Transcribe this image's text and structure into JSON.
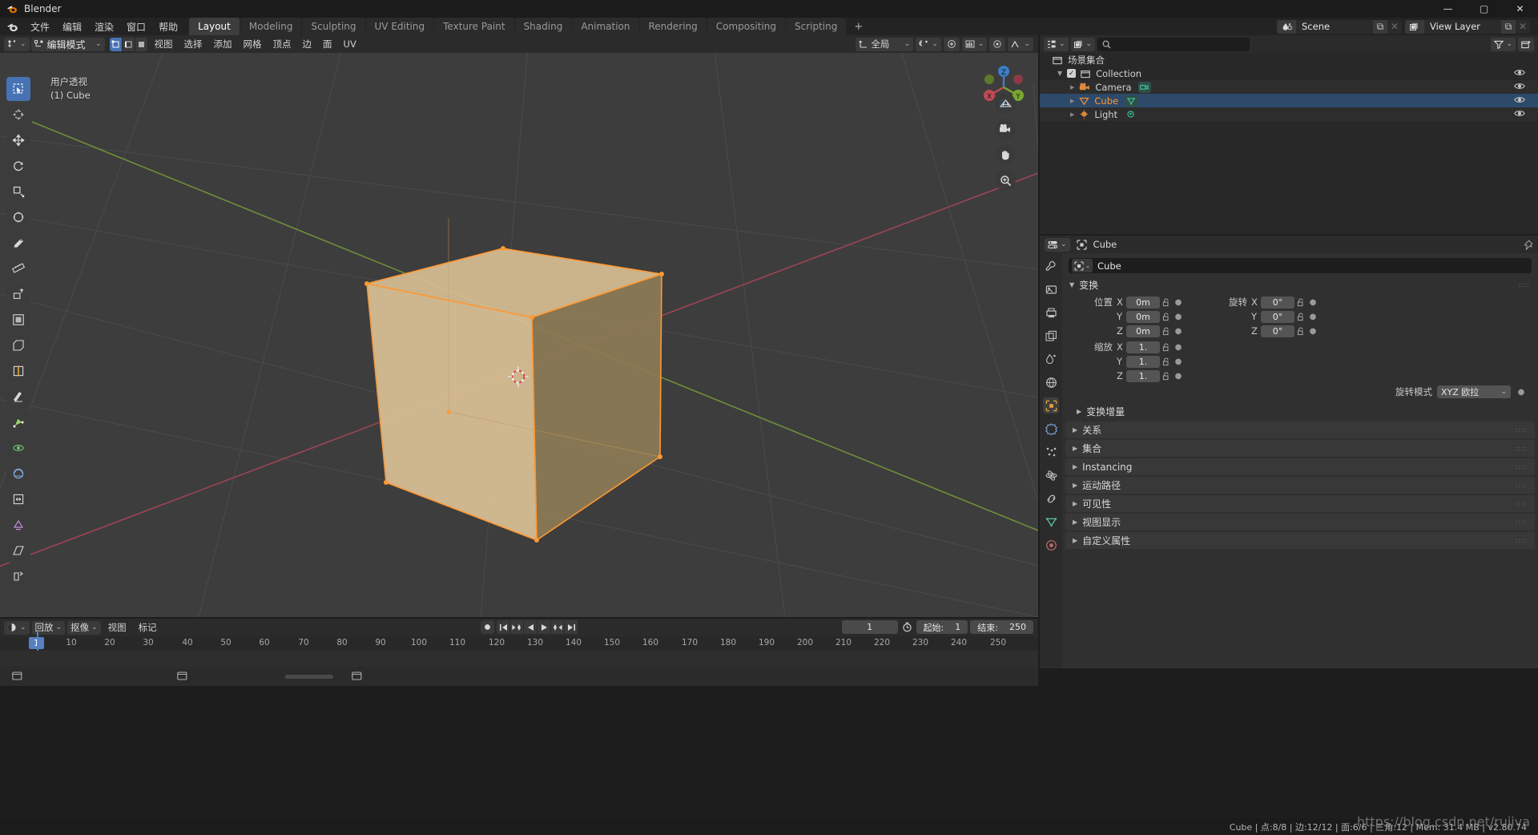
{
  "window": {
    "title": "Blender",
    "minimize_label": "—",
    "maximize_label": "▢",
    "close_label": "✕"
  },
  "topbar": {
    "menus": [
      "文件",
      "编辑",
      "渲染",
      "窗口",
      "帮助"
    ],
    "workspaces": [
      {
        "label": "Layout",
        "active": true
      },
      {
        "label": "Modeling",
        "active": false
      },
      {
        "label": "Sculpting",
        "active": false
      },
      {
        "label": "UV Editing",
        "active": false
      },
      {
        "label": "Texture Paint",
        "active": false
      },
      {
        "label": "Shading",
        "active": false
      },
      {
        "label": "Animation",
        "active": false
      },
      {
        "label": "Rendering",
        "active": false
      },
      {
        "label": "Compositing",
        "active": false
      },
      {
        "label": "Scripting",
        "active": false
      }
    ],
    "add_workspace_label": "+",
    "scene": {
      "name": "Scene",
      "new_label": "⧉",
      "unlink_label": "✕"
    },
    "view_layer": {
      "name": "View Layer",
      "new_label": "⧉",
      "unlink_label": "✕"
    }
  },
  "viewport": {
    "mode": "编辑模式",
    "select_modes": [
      {
        "name": "vertex-select",
        "active": true
      },
      {
        "name": "edge-select",
        "active": false
      },
      {
        "name": "face-select",
        "active": false
      }
    ],
    "menus": [
      "视图",
      "选择",
      "添加",
      "网格",
      "顶点",
      "边",
      "面",
      "UV"
    ],
    "transform_orientation": "全局",
    "overlay_text_line1": "用户透视",
    "overlay_text_line2": "(1) Cube",
    "gizmo_axes": {
      "x": "X",
      "y": "Y",
      "z": "Z"
    },
    "nav_buttons": [
      "grid-toggle",
      "camera-view",
      "pan-view",
      "zoom-view"
    ],
    "tools": [
      {
        "name": "select-box",
        "active": true
      },
      {
        "name": "cursor",
        "active": false
      },
      {
        "name": "move",
        "active": false
      },
      {
        "name": "rotate",
        "active": false
      },
      {
        "name": "scale",
        "active": false
      },
      {
        "name": "transform",
        "active": false
      },
      {
        "name": "annotate",
        "active": false
      },
      {
        "name": "measure",
        "active": false
      },
      {
        "name": "extrude-region",
        "active": false
      },
      {
        "name": "inset-faces",
        "active": false
      },
      {
        "name": "bevel",
        "active": false
      },
      {
        "name": "loop-cut",
        "active": false
      },
      {
        "name": "knife",
        "active": false
      },
      {
        "name": "poly-build",
        "active": false
      },
      {
        "name": "spin",
        "active": false
      },
      {
        "name": "smooth",
        "active": false
      },
      {
        "name": "edge-slide",
        "active": false
      },
      {
        "name": "shrink-fatten",
        "active": false
      },
      {
        "name": "shear",
        "active": false
      },
      {
        "name": "rip-region",
        "active": false
      }
    ]
  },
  "outliner": {
    "search_placeholder": "",
    "root_label": "场景集合",
    "items": [
      {
        "label": "Collection",
        "type": "collection",
        "indent": 1,
        "selected": false,
        "expander": "▼",
        "checkbox": true
      },
      {
        "label": "Camera",
        "type": "camera",
        "indent": 2,
        "selected": false,
        "expander": "▶",
        "checkbox": false
      },
      {
        "label": "Cube",
        "type": "mesh",
        "indent": 2,
        "selected": true,
        "expander": "▶",
        "checkbox": false
      },
      {
        "label": "Light",
        "type": "light",
        "indent": 2,
        "selected": false,
        "expander": "▶",
        "checkbox": false
      }
    ]
  },
  "properties": {
    "breadcrumb_object": "Cube",
    "name_value": "Cube",
    "transform": {
      "title": "变换",
      "location_label": "位置",
      "rotation_label": "旋转",
      "scale_label": "缩放",
      "axes": [
        "X",
        "Y",
        "Z"
      ],
      "location": [
        "0m",
        "0m",
        "0m"
      ],
      "rotation": [
        "0°",
        "0°",
        "0°"
      ],
      "scale": [
        "1.",
        "1.",
        "1."
      ],
      "rotation_mode_label": "旋转模式",
      "rotation_mode_value": "XYZ 欧拉"
    },
    "panels": [
      {
        "label": "变换增量",
        "sub": true
      },
      {
        "label": "关系",
        "sub": false
      },
      {
        "label": "集合",
        "sub": false
      },
      {
        "label": "Instancing",
        "sub": false
      },
      {
        "label": "运动路径",
        "sub": false
      },
      {
        "label": "可见性",
        "sub": false
      },
      {
        "label": "视图显示",
        "sub": false
      },
      {
        "label": "自定义属性",
        "sub": false
      }
    ],
    "tabs": [
      {
        "name": "tool",
        "active": false
      },
      {
        "name": "render",
        "active": false
      },
      {
        "name": "output",
        "active": false
      },
      {
        "name": "view-layer",
        "active": false
      },
      {
        "name": "scene",
        "active": false
      },
      {
        "name": "world",
        "active": false
      },
      {
        "name": "object",
        "active": true
      },
      {
        "name": "modifiers",
        "active": false
      },
      {
        "name": "particles",
        "active": false
      },
      {
        "name": "physics",
        "active": false
      },
      {
        "name": "constraints",
        "active": false
      },
      {
        "name": "object-data",
        "active": false
      },
      {
        "name": "material",
        "active": false
      }
    ]
  },
  "timeline": {
    "menus": [
      "回放",
      "抠像",
      "视图",
      "标记"
    ],
    "current_frame": "1",
    "start_label": "起始:",
    "start_value": "1",
    "end_label": "结束:",
    "end_value": "250",
    "playhead_label": "1",
    "ticks": [
      "10",
      "20",
      "30",
      "40",
      "50",
      "60",
      "70",
      "80",
      "90",
      "100",
      "110",
      "120",
      "130",
      "140",
      "150",
      "160",
      "170",
      "180",
      "190",
      "200",
      "210",
      "220",
      "230",
      "240",
      "250"
    ],
    "transport": [
      "jump-start",
      "prev-keyframe",
      "play-reverse",
      "play",
      "next-keyframe",
      "jump-end"
    ],
    "record_label": "●"
  },
  "statusbar": {
    "info": "Cube | 点:8/8 | 边:12/12 | 面:6/6 | 三角:12 | Mem: 31.4 MB | v2.80.74",
    "watermark": "https://blog.csdn.net/rujiva"
  },
  "colors": {
    "accent_blue": "#4772b3",
    "selected_orange": "#ff9833",
    "axis_x": "#c04a55",
    "axis_y": "#7aa82f",
    "axis_z": "#3c7ec8",
    "cube_face_light": "#d4b98d",
    "cube_face_dark": "#8f7c55",
    "viewport_bg": "#3d3d3d"
  }
}
